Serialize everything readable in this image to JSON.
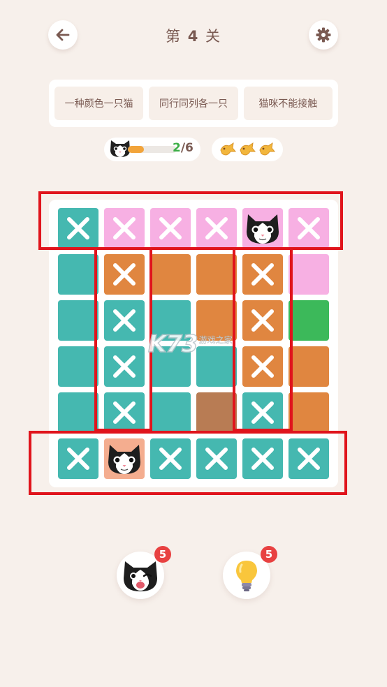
{
  "header": {
    "title_prefix": "第",
    "level": "4",
    "title_suffix": "关"
  },
  "rules": [
    "一种颜色一只猫",
    "同行同列各一只",
    "猫咪不能接触"
  ],
  "progress": {
    "found": "2",
    "total": "/6",
    "fraction": 0.33
  },
  "fish_hints": 3,
  "colors": {
    "teal": "#45b8b0",
    "orange": "#e08640",
    "pink": "#f7b0e3",
    "green": "#3cb95a",
    "brown": "#b87c54",
    "peach": "#f4ad8f",
    "highlight": "#e0141c"
  },
  "board": {
    "rows": [
      [
        {
          "c": "teal",
          "m": "x"
        },
        {
          "c": "pink",
          "m": "x"
        },
        {
          "c": "pink",
          "m": "x"
        },
        {
          "c": "pink",
          "m": "x"
        },
        {
          "c": "pink",
          "m": "cat"
        },
        {
          "c": "pink",
          "m": "x"
        }
      ],
      [
        {
          "c": "teal",
          "m": ""
        },
        {
          "c": "orange",
          "m": "x"
        },
        {
          "c": "orange",
          "m": ""
        },
        {
          "c": "orange",
          "m": ""
        },
        {
          "c": "orange",
          "m": "x"
        },
        {
          "c": "pink",
          "m": ""
        }
      ],
      [
        {
          "c": "teal",
          "m": ""
        },
        {
          "c": "teal",
          "m": "x"
        },
        {
          "c": "teal",
          "m": ""
        },
        {
          "c": "orange",
          "m": ""
        },
        {
          "c": "orange",
          "m": "x"
        },
        {
          "c": "green",
          "m": ""
        }
      ],
      [
        {
          "c": "teal",
          "m": ""
        },
        {
          "c": "teal",
          "m": "x"
        },
        {
          "c": "teal",
          "m": ""
        },
        {
          "c": "teal",
          "m": ""
        },
        {
          "c": "orange",
          "m": "x"
        },
        {
          "c": "orange",
          "m": ""
        }
      ],
      [
        {
          "c": "teal",
          "m": ""
        },
        {
          "c": "teal",
          "m": "x"
        },
        {
          "c": "teal",
          "m": ""
        },
        {
          "c": "brown",
          "m": ""
        },
        {
          "c": "teal",
          "m": "x"
        },
        {
          "c": "orange",
          "m": ""
        }
      ],
      [
        {
          "c": "teal",
          "m": "x"
        },
        {
          "c": "peach",
          "m": "cat"
        },
        {
          "c": "teal",
          "m": "x"
        },
        {
          "c": "teal",
          "m": "x"
        },
        {
          "c": "teal",
          "m": "x"
        },
        {
          "c": "teal",
          "m": "x"
        }
      ]
    ]
  },
  "watermark": {
    "logo": "K73",
    "text": "游戏之家"
  },
  "tools": {
    "cat_hint_count": "5",
    "bulb_hint_count": "5",
    "cat_icon": "winking-cat-icon",
    "bulb_icon": "lightbulb-icon"
  }
}
